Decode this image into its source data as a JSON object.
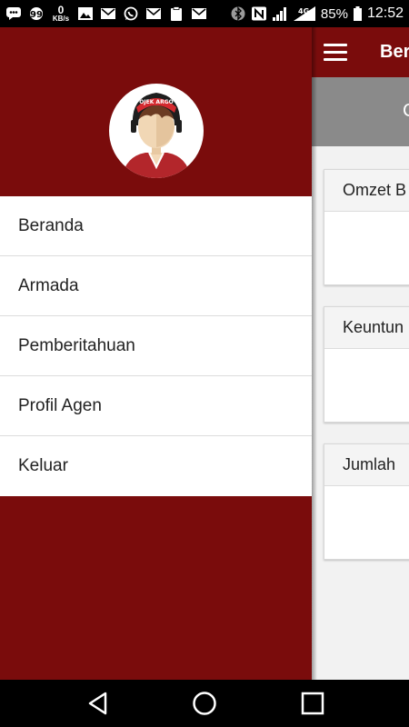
{
  "status_bar": {
    "speed_value": "0",
    "speed_unit": "KB/s",
    "network": "4G",
    "battery": "85%",
    "time": "12:52",
    "icons": [
      "chat-icon",
      "message-icon",
      "image-icon",
      "mail-icon",
      "whatsapp-icon",
      "mail-icon",
      "clipboard-icon",
      "mail-icon",
      "bluetooth-icon",
      "nfc-icon",
      "signal-icon",
      "battery-icon"
    ]
  },
  "app": {
    "title": "Ber",
    "tab_label": "C",
    "cards": [
      {
        "title": "Omzet B"
      },
      {
        "title": "Keuntun"
      },
      {
        "title": "Jumlah"
      }
    ]
  },
  "drawer": {
    "logo_text": "OJEK ARGO",
    "menu": [
      {
        "label": "Beranda"
      },
      {
        "label": "Armada"
      },
      {
        "label": "Pemberitahuan"
      },
      {
        "label": "Profil Agen"
      },
      {
        "label": "Keluar"
      }
    ]
  },
  "colors": {
    "primary": "#7a0c0c",
    "appbar_gray": "#8a8a8a",
    "drawer_bg": "#ffffff"
  }
}
